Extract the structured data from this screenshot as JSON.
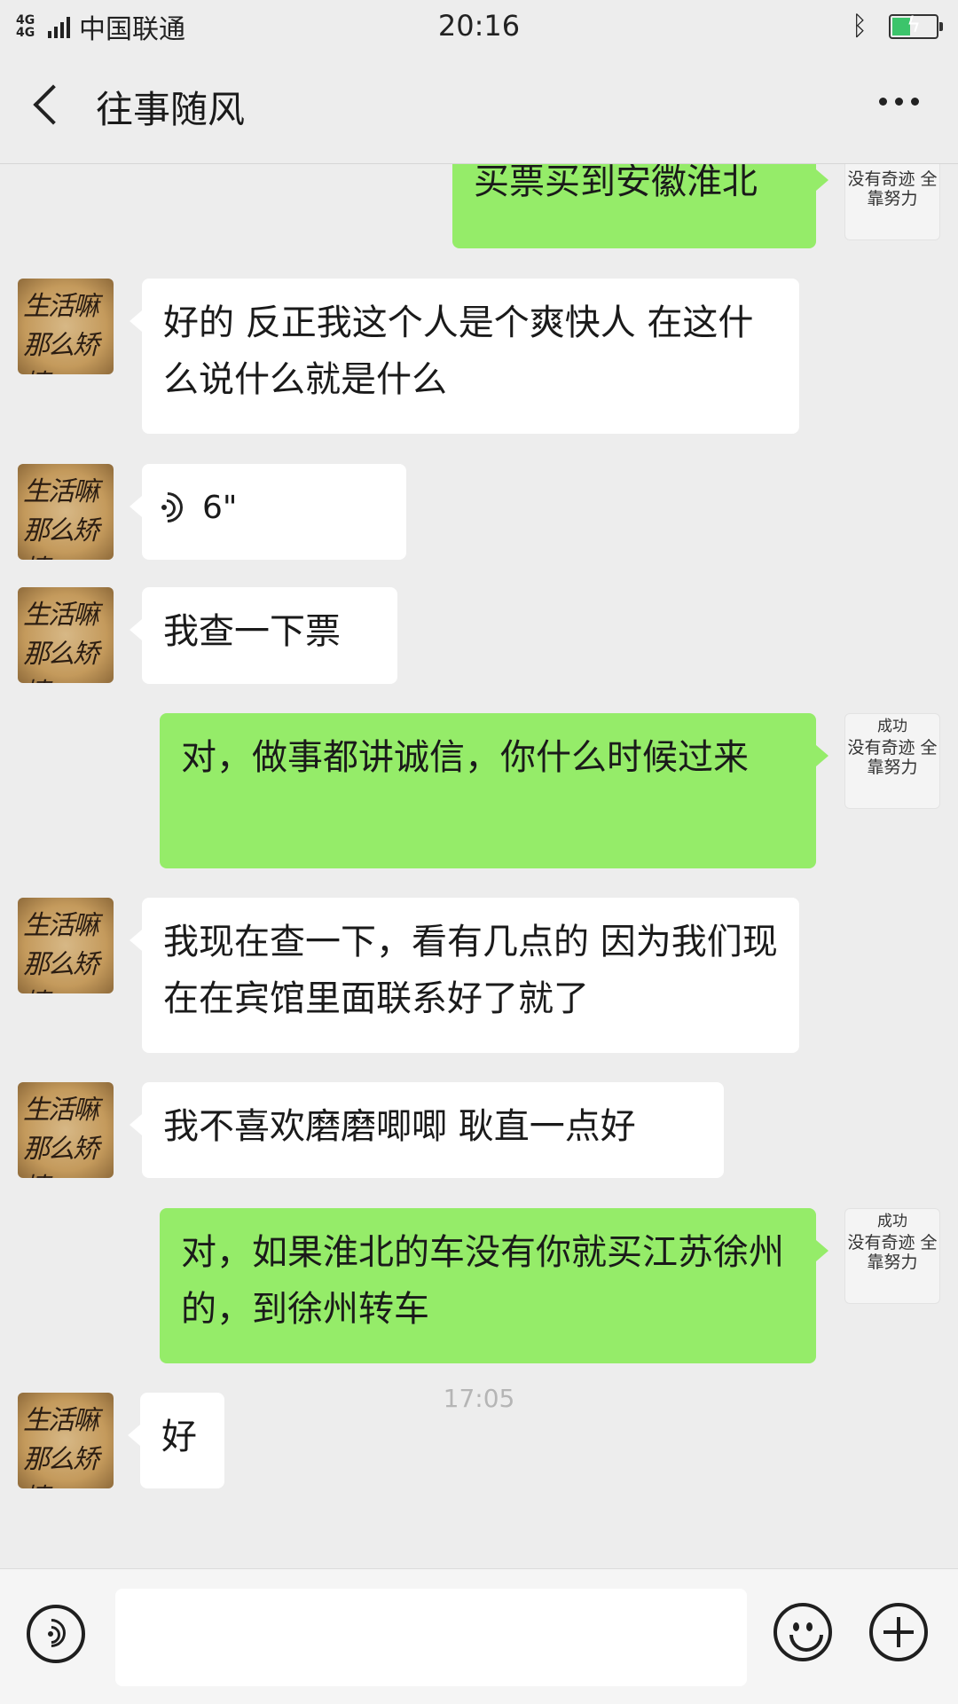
{
  "status_bar": {
    "network": "4G 4G",
    "carrier": "中国联通",
    "time": "20:16",
    "bluetooth_icon": "bluetooth-icon",
    "battery_icon": "battery-charging-icon"
  },
  "header": {
    "title": "往事随风",
    "back_icon": "back-arrow-icon",
    "more_icon": "more-dots-icon"
  },
  "avatars": {
    "contact_text": "生活嘛 那么矫情",
    "me_line1": "成功",
    "me_line2": "没有奇迹 全靠努力"
  },
  "messages": [
    {
      "from": "me",
      "text": "买票买到安徽淮北"
    },
    {
      "from": "contact",
      "text": "好的 反正我这个人是个爽快人 在这什么说什么就是什么"
    },
    {
      "from": "contact",
      "type": "voice",
      "text": "6\""
    },
    {
      "from": "contact",
      "text": "我查一下票"
    },
    {
      "from": "me",
      "text": "对，做事都讲诚信，你什么时候过来"
    },
    {
      "from": "contact",
      "text": "我现在查一下，看有几点的 因为我们现在在宾馆里面联系好了就了"
    },
    {
      "from": "contact",
      "text": "我不喜欢磨磨唧唧 耿直一点好"
    },
    {
      "from": "me",
      "text": "对，如果淮北的车没有你就买江苏徐州的，到徐州转车"
    },
    {
      "from": "contact",
      "text": "好"
    }
  ],
  "time_divider": "17:05",
  "input_bar": {
    "value": "",
    "voice_icon": "voice-input-icon",
    "emoji_icon": "emoji-icon",
    "plus_icon": "plus-icon"
  }
}
